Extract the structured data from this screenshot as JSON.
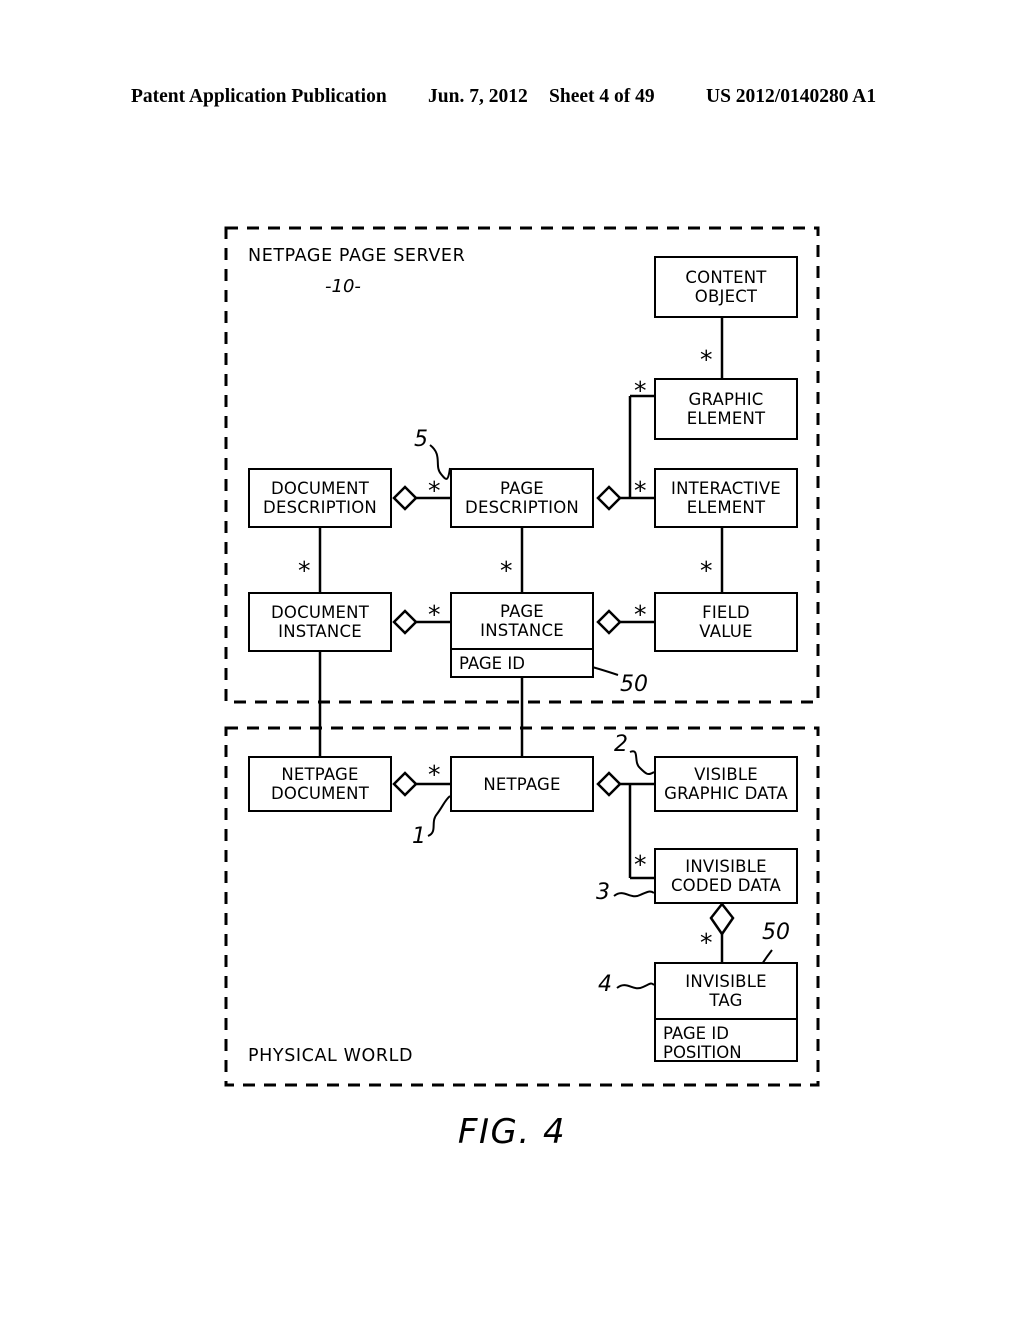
{
  "header": {
    "publication": "Patent Application Publication",
    "date": "Jun. 7, 2012",
    "sheet": "Sheet 4 of 49",
    "number": "US 2012/0140280 A1"
  },
  "figure": {
    "caption": "FIG. 4"
  },
  "containers": [
    {
      "id": "page-server",
      "label": "NETPAGE PAGE SERVER",
      "sublabel": "-10-"
    },
    {
      "id": "physical-world",
      "label": "PHYSICAL WORLD",
      "sublabel": ""
    }
  ],
  "nodes": {
    "content_object": {
      "title": "CONTENT\nOBJECT"
    },
    "graphic_element": {
      "title": "GRAPHIC\nELEMENT"
    },
    "interactive_element": {
      "title": "INTERACTIVE\nELEMENT"
    },
    "document_description": {
      "title": "DOCUMENT\nDESCRIPTION"
    },
    "page_description": {
      "title": "PAGE\nDESCRIPTION"
    },
    "document_instance": {
      "title": "DOCUMENT\nINSTANCE"
    },
    "page_instance": {
      "title": "PAGE\nINSTANCE",
      "compartment": "PAGE ID"
    },
    "field_value": {
      "title": "FIELD\nVALUE"
    },
    "netpage_document": {
      "title": "NETPAGE\nDOCUMENT"
    },
    "netpage": {
      "title": "NETPAGE"
    },
    "visible_graphic_data": {
      "title": "VISIBLE\nGRAPHIC DATA"
    },
    "invisible_coded_data": {
      "title": "INVISIBLE\nCODED DATA"
    },
    "invisible_tag": {
      "title": "INVISIBLE\nTAG",
      "compartment": "PAGE ID\nPOSITION"
    }
  },
  "multiplicities": {
    "content_to_graphic": "*",
    "graphic_to_page_desc": "*",
    "interactive_to_page_desc": "*",
    "doc_desc_to_page_desc": "*",
    "doc_desc_to_doc_inst": "*",
    "page_desc_to_page_inst": "*",
    "interactive_to_field": "*",
    "doc_inst_to_page_inst": "*",
    "page_inst_to_field": "*",
    "netpage_doc_to_netpage": "*",
    "netpage_to_invisible_coded": "*",
    "coded_to_tag": "*"
  },
  "references": {
    "page_description": "5",
    "page_id": "50",
    "netpage": "1",
    "visible_graphic_data": "2",
    "invisible_coded_data": "3",
    "invisible_tag": "4",
    "tag_page_id": "50"
  },
  "colors": {
    "ink": "#000000",
    "paper": "#ffffff"
  }
}
